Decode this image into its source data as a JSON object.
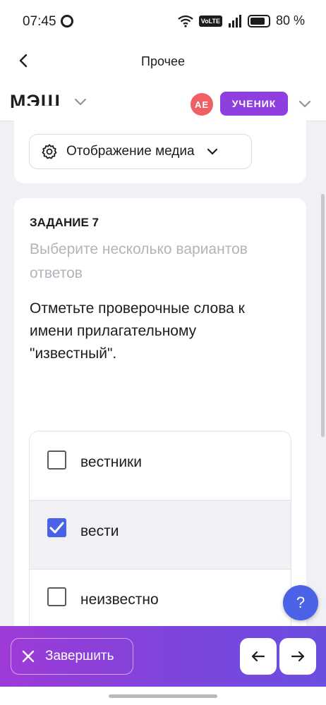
{
  "status_bar": {
    "time": "07:45",
    "network_badge": "VoLTE",
    "battery": "80 %"
  },
  "nav": {
    "title": "Прочее"
  },
  "app_header": {
    "logo": "МЭШ",
    "avatar_initials": "АЕ",
    "role": "УЧЕНИК"
  },
  "media": {
    "label": "Отображение медиа"
  },
  "task": {
    "title": "ЗАДАНИЕ 7",
    "hint": "Выберите несколько вариантов ответов",
    "question": "Отметьте проверочные слова к имени прилагательному \"известный\".",
    "options": [
      {
        "label": "вестники",
        "checked": false
      },
      {
        "label": "вести",
        "checked": true
      },
      {
        "label": "неизвестно",
        "checked": false
      }
    ]
  },
  "help": {
    "label": "?"
  },
  "footer": {
    "finish_label": "Завершить"
  },
  "colors": {
    "accent": "#4a63e6",
    "role_badge": "#8f3fe0",
    "avatar": "#ef5f63",
    "bottom_bar_start": "#9e3ad7",
    "bottom_bar_end": "#6a4ee0"
  }
}
